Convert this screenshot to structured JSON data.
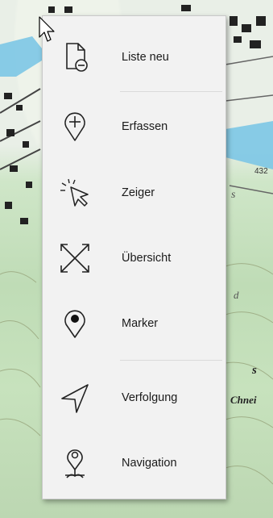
{
  "menu": {
    "items": [
      {
        "label": "Liste neu",
        "icon": "list-new-icon"
      },
      {
        "label": "Erfassen",
        "icon": "pin-add-icon"
      },
      {
        "label": "Zeiger",
        "icon": "pointer-icon"
      },
      {
        "label": "Übersicht",
        "icon": "overview-icon"
      },
      {
        "label": "Marker",
        "icon": "marker-icon"
      },
      {
        "label": "Verfolgung",
        "icon": "navigation-arrow-icon"
      },
      {
        "label": "Navigation",
        "icon": "navigation-pin-icon"
      }
    ]
  },
  "map": {
    "labels": [
      "Chnei",
      "s",
      "s",
      "d"
    ],
    "number_label": "432"
  }
}
